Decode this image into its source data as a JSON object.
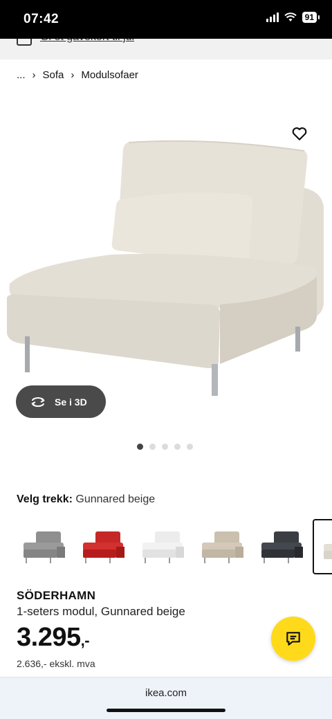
{
  "status_bar": {
    "time": "07:42",
    "battery": "91"
  },
  "gift": {
    "link_text": "Gi et gavekort til jul"
  },
  "breadcrumb": {
    "ellipsis": "...",
    "items": [
      "Sofa",
      "Modulsofaer"
    ]
  },
  "product_image": {
    "view_3d_label": "Se i 3D",
    "gallery_count": 5,
    "gallery_active_index": 0
  },
  "variant": {
    "label": "Velg trekk:",
    "selected_value": "Gunnared beige",
    "swatch_colors": [
      "#8f8f8f",
      "#c62828",
      "#ececec",
      "#cbbfae",
      "#3a3d42",
      "#e4dfd6"
    ],
    "selected_swatch_index": 5
  },
  "product": {
    "name": "SÖDERHAMN",
    "description": "1-seters modul, Gunnared beige",
    "price": "3.295",
    "price_suffix": ",-",
    "price_excl_vat": "2.636,- ekskl. mva"
  },
  "browser": {
    "url": "ikea.com"
  },
  "colors": {
    "chat_button": "#ffda1a",
    "sofa_fabric": "#e5e0d6",
    "btn_3d": "#4a4a4a"
  }
}
